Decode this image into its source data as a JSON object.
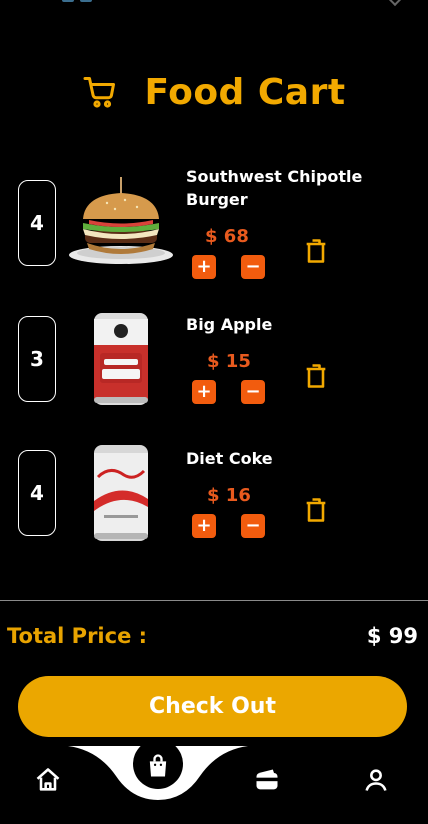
{
  "header": {
    "title": "Food Cart",
    "cart_icon": "shopping-cart-icon"
  },
  "items": [
    {
      "qty": "4",
      "name": "Southwest Chipotle Burger",
      "price": "$ 68",
      "image": "burger-image"
    },
    {
      "qty": "3",
      "name": "Big Apple",
      "price": "$ 15",
      "image": "big-apple-can-image"
    },
    {
      "qty": "4",
      "name": "Diet Coke",
      "price": "$ 16",
      "image": "diet-coke-can-image"
    }
  ],
  "controls": {
    "plus": "+",
    "minus": "−"
  },
  "summary": {
    "total_label": "Total Price :",
    "total_value": "$ 99"
  },
  "checkout": {
    "label": "Check Out"
  },
  "nav": {
    "items": [
      "home-icon",
      "shopping-bag-icon",
      "wallet-icon",
      "profile-icon"
    ],
    "active": "shopping-bag-icon"
  },
  "colors": {
    "accent": "#F2A900",
    "price": "#E85A1E",
    "button": "#F25C0E",
    "background": "#000000"
  }
}
